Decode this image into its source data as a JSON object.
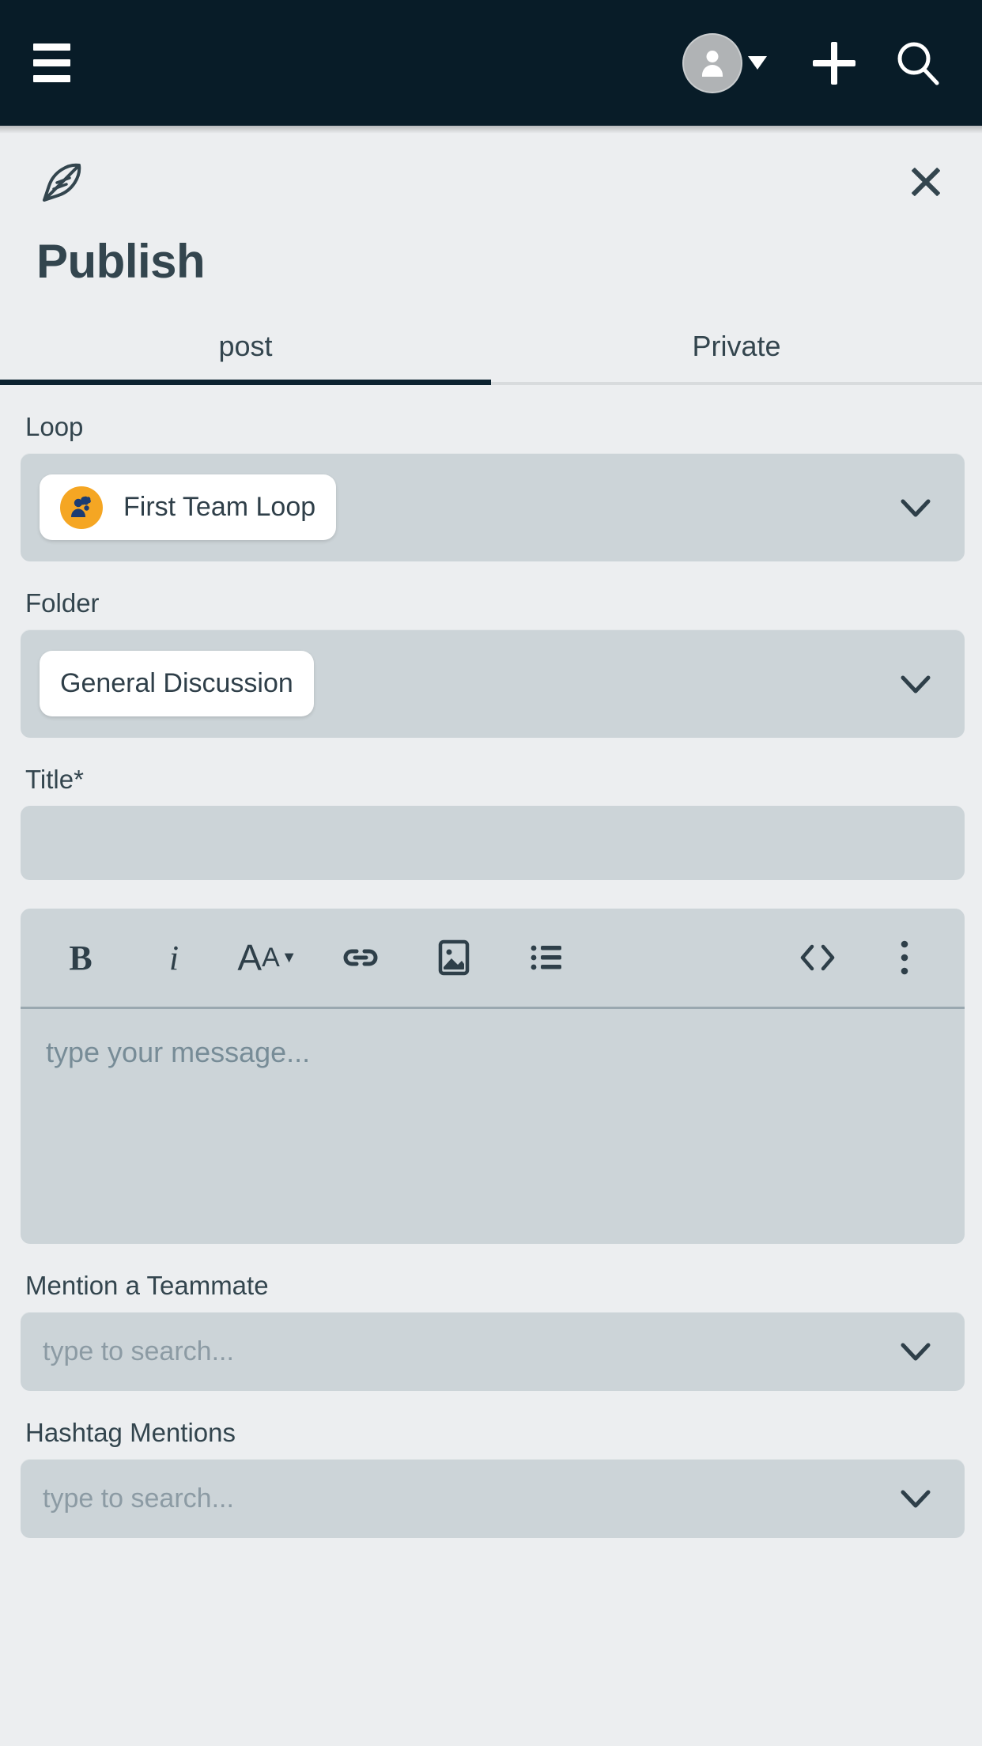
{
  "top_bar": {
    "menu_icon": "hamburger-menu-icon",
    "account_icon": "user-avatar-icon",
    "account_caret_icon": "caret-down-icon",
    "add_icon": "plus-icon",
    "search_icon": "search-icon"
  },
  "sheet": {
    "brand_icon": "feather-quill-icon",
    "close_icon": "close-x-icon",
    "title": "Publish",
    "tabs": [
      {
        "label": "post",
        "active": true
      },
      {
        "label": "Private",
        "active": false
      }
    ]
  },
  "form": {
    "loop": {
      "label": "Loop",
      "selected": "First Team Loop",
      "avatar_icon": "team-loop-avatar-icon",
      "avatar_color": "#f5a623",
      "chevron_icon": "chevron-down-icon"
    },
    "folder": {
      "label": "Folder",
      "selected": "General Discussion",
      "chevron_icon": "chevron-down-icon"
    },
    "title_field": {
      "label": "Title*",
      "value": "",
      "placeholder": ""
    },
    "editor": {
      "toolbar": [
        {
          "name": "bold",
          "glyph": "B"
        },
        {
          "name": "italic",
          "glyph": "i"
        },
        {
          "name": "font-size",
          "glyph": "AA"
        },
        {
          "name": "link",
          "glyph": "link-icon"
        },
        {
          "name": "image",
          "glyph": "image-icon"
        },
        {
          "name": "bullet-list",
          "glyph": "list-icon"
        },
        {
          "name": "code",
          "glyph": "code-icon"
        },
        {
          "name": "more",
          "glyph": "kebab-menu-icon"
        }
      ],
      "placeholder": "type your message..."
    },
    "mention_teammate": {
      "label": "Mention a Teammate",
      "placeholder": "type to search...",
      "chevron_icon": "chevron-down-icon"
    },
    "hashtag_mentions": {
      "label": "Hashtag Mentions",
      "placeholder": "type to search...",
      "chevron_icon": "chevron-down-icon"
    }
  },
  "colors": {
    "app_bar": "#081c28",
    "page_background": "#eceef0",
    "field_fill": "#ccd4d8",
    "text_primary": "#33454e",
    "text_placeholder": "#8c9ba4",
    "accent_avatar": "#f5a623",
    "tab_indicator": "#0c2330"
  }
}
